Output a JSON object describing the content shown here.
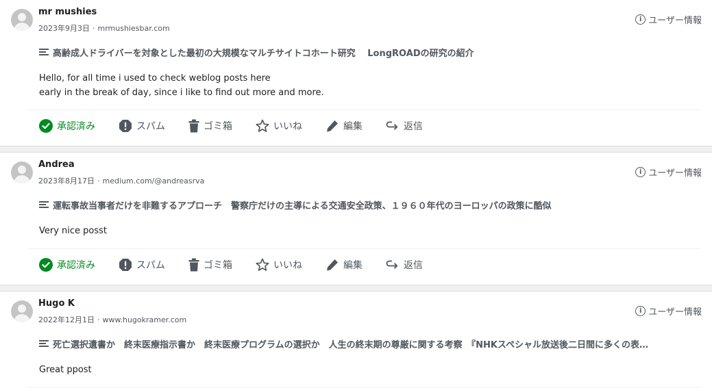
{
  "comments": [
    {
      "author": "mr mushies",
      "date": "2023年9月3日",
      "site": "mrmushiesbar.com",
      "user_info_label": "ユーザー情報",
      "post_title": "高齢成人ドライバーを対象とした最初の大規模なマルチサイトコホート研究　 LongROADの研究の紹介",
      "content_lines": [
        "Hello, for all time i used to check weblog posts here",
        "early in the break of day, since i like to find out more and more."
      ],
      "actions": {
        "approved": "承認済み",
        "spam": "スパム",
        "trash": "ゴミ箱",
        "like": "いいね",
        "edit": "編集",
        "reply": "返信"
      }
    },
    {
      "author": "Andrea",
      "date": "2023年8月17日",
      "site": "medium.com/@andreasrva",
      "user_info_label": "ユーザー情報",
      "post_title": "運転事故当事者だけを非難するアプローチ　警察庁だけの主導による交通安全政策、１９６０年代のヨーロッパの政策に酷似",
      "content_lines": [
        "Very nice posst"
      ],
      "actions": {
        "approved": "承認済み",
        "spam": "スパム",
        "trash": "ゴミ箱",
        "like": "いいね",
        "edit": "編集",
        "reply": "返信"
      }
    },
    {
      "author": "Hugo K",
      "date": "2022年12月1日",
      "site": "www.hugokramer.com",
      "user_info_label": "ユーザー情報",
      "post_title": "死亡選択遺書か　終末医療指示書か　終末医療プログラムの選択か　人生の終末期の尊厳に関する考察　『NHKスペシャル放送後二日間に多くの表…",
      "content_lines": [
        "Great ppost"
      ]
    }
  ],
  "meta_separator": "·",
  "colors": {
    "approved": "#008a20",
    "muted": "#50575e",
    "text": "#1e1e1e"
  }
}
